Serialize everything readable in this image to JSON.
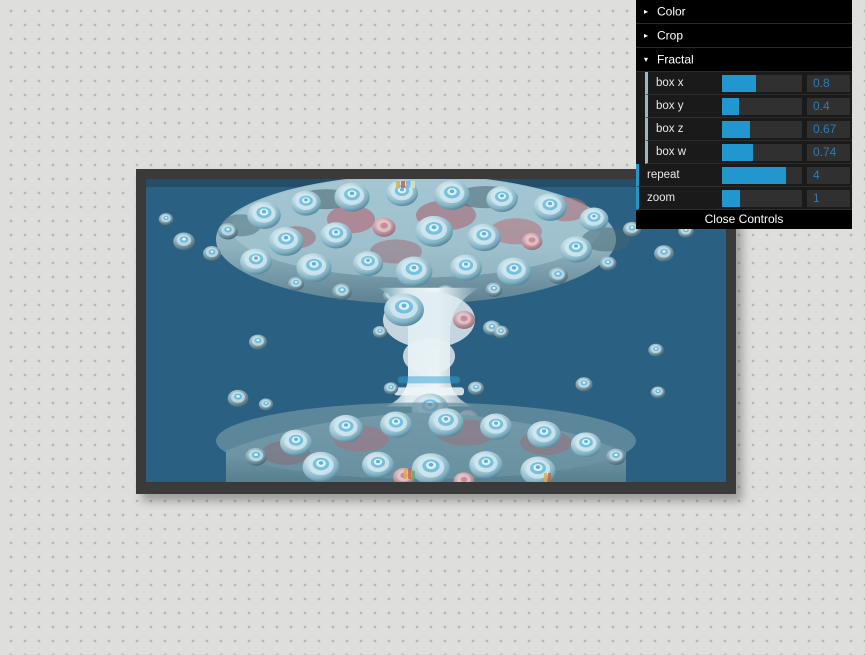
{
  "app": {
    "background_color": "#dededc",
    "accent_color": "#2196cf"
  },
  "viewport": {
    "name": "fractal-render-viewport",
    "frame_color": "#3a3a3a",
    "background_color": "#2a6183",
    "description": "3D raymarched Mandelbox fractal render, pale blue-white ribbed spheres with pink accents over a teal background"
  },
  "control_panel": {
    "folders": [
      {
        "label": "Color",
        "expanded": false,
        "arrow": "triangle-right-icon"
      },
      {
        "label": "Crop",
        "expanded": false,
        "arrow": "triangle-right-icon"
      },
      {
        "label": "Fractal",
        "expanded": true,
        "arrow": "triangle-down-icon"
      }
    ],
    "sliders": [
      {
        "label": "box x",
        "value": "0.8",
        "fill_percent": 42,
        "indent": "inner"
      },
      {
        "label": "box y",
        "value": "0.4",
        "fill_percent": 21,
        "indent": "inner"
      },
      {
        "label": "box z",
        "value": "0.67",
        "fill_percent": 35,
        "indent": "inner"
      },
      {
        "label": "box w",
        "value": "0.74",
        "fill_percent": 39,
        "indent": "inner"
      },
      {
        "label": "repeat",
        "value": "4",
        "fill_percent": 80,
        "indent": "outer"
      },
      {
        "label": "zoom",
        "value": "1",
        "fill_percent": 22,
        "indent": "outer"
      }
    ],
    "close_label": "Close Controls"
  }
}
